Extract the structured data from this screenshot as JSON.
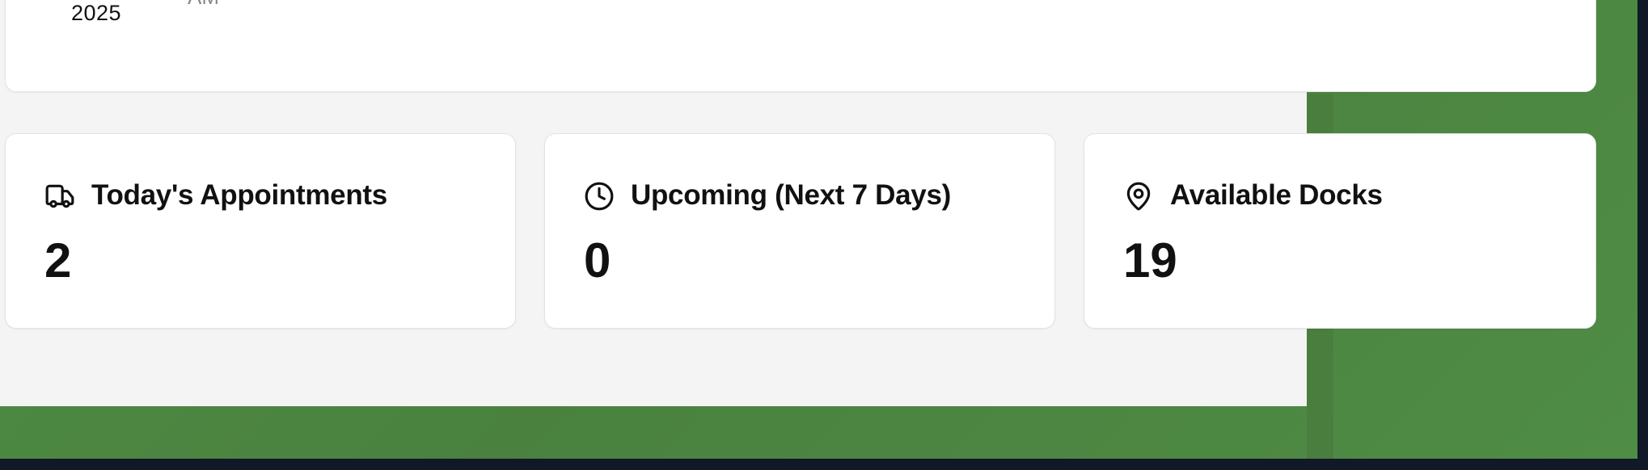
{
  "header": {
    "date_year": "2025",
    "time_partial": "AM"
  },
  "stats": [
    {
      "label": "Today's Appointments",
      "value": "2",
      "icon": "truck-icon"
    },
    {
      "label": "Upcoming (Next 7 Days)",
      "value": "0",
      "icon": "clock-icon"
    },
    {
      "label": "Available Docks",
      "value": "19",
      "icon": "map-pin-icon"
    }
  ],
  "colors": {
    "accent_green": "#4f8d44",
    "panel_bg": "#f4f4f4",
    "frame_dark": "#111827"
  }
}
